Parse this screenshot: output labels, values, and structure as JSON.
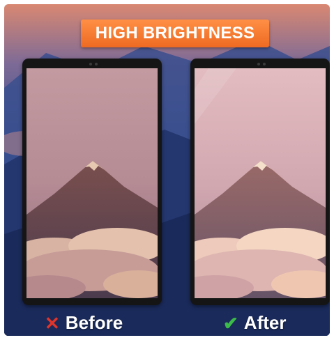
{
  "banner": {
    "title": "HIGH BRIGHTNESS"
  },
  "comparison": {
    "before": {
      "label": "Before",
      "icon": "cross-icon",
      "icon_color": "#e0352b"
    },
    "after": {
      "label": "After",
      "icon": "check-icon",
      "icon_color": "#3cba4a"
    }
  },
  "colors": {
    "banner": "#f47a30",
    "background": "#1e2f66"
  }
}
